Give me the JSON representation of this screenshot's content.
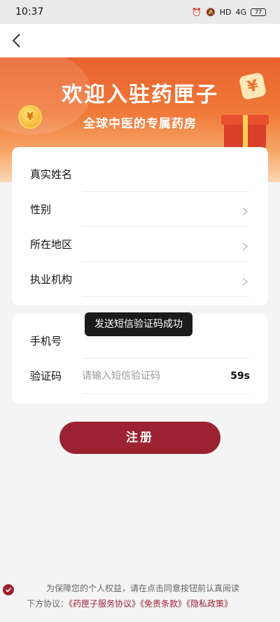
{
  "status": {
    "time": "10:37",
    "network": "HD",
    "signal": "4G",
    "battery": "77"
  },
  "banner": {
    "title": "欢迎入驻药匣子",
    "subtitle": "全球中医的专属药房",
    "yen": "¥"
  },
  "form": {
    "fields": [
      {
        "label": "真实姓名"
      },
      {
        "label": "性别"
      },
      {
        "label": "所在地区"
      },
      {
        "label": "执业机构"
      }
    ],
    "phone_label": "手机号",
    "code_label": "验证码",
    "code_placeholder": "请输入短信验证码",
    "countdown": "59s"
  },
  "toast": "发送短信验证码成功",
  "register_label": "注册",
  "agreement": {
    "line1": "为保障您的个人权益，请在点击同意按钮前认真阅读",
    "line2_prefix": "下方协议：",
    "links": [
      "《药匣子服务协议》",
      "《免责条款》",
      "《隐私政策》"
    ]
  },
  "colors": {
    "primary": "#9b2230",
    "banner_top": "#e8622e",
    "banner_bottom": "#fbd7b3"
  }
}
